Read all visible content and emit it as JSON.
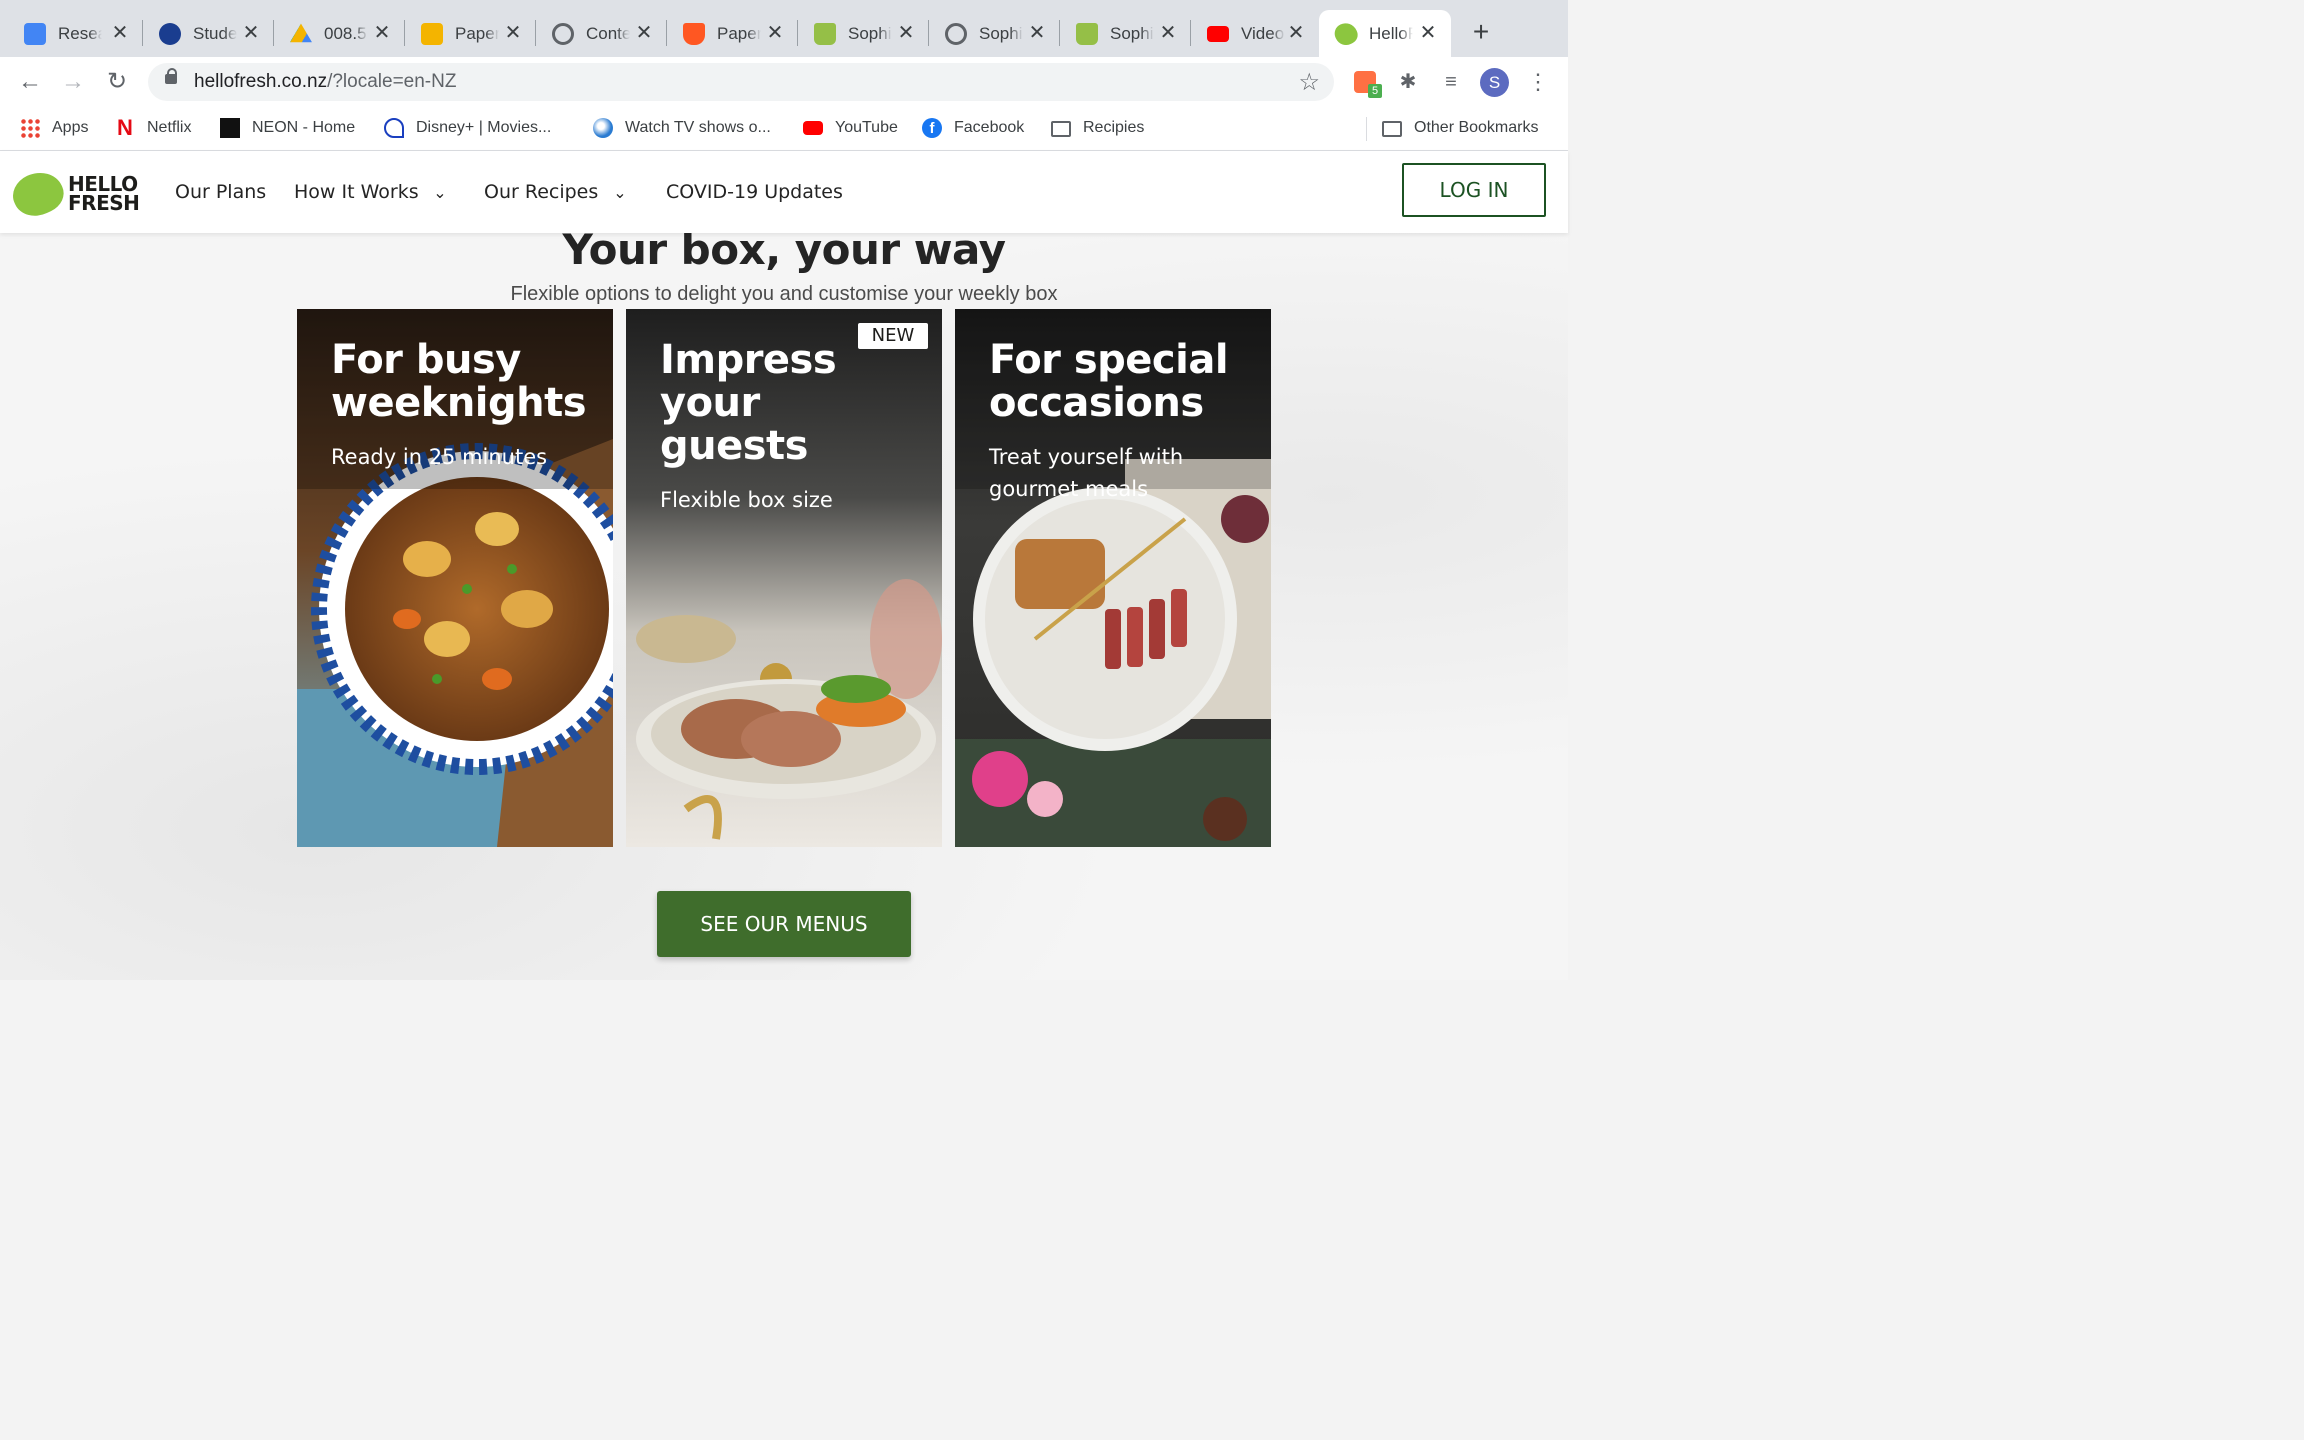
{
  "tabs": [
    {
      "title": "Research",
      "icon": "google-docs-icon",
      "color": "#4285f4"
    },
    {
      "title": "Student",
      "icon": "student-portal-icon",
      "color": "#1a3d8f"
    },
    {
      "title": "008.5",
      "icon": "google-drive-icon",
      "color": "#0f9d58"
    },
    {
      "title": "Paper",
      "icon": "google-slides-icon",
      "color": "#f4b400"
    },
    {
      "title": "Content",
      "icon": "globe-icon",
      "color": "#5f6368"
    },
    {
      "title": "Paper",
      "icon": "cup-icon",
      "color": "#ff5722"
    },
    {
      "title": "Sophia",
      "icon": "shopify-icon",
      "color": "#95bf47"
    },
    {
      "title": "Sophia",
      "icon": "globe-icon",
      "color": "#5f6368"
    },
    {
      "title": "Sophia",
      "icon": "shopify-icon",
      "color": "#95bf47"
    },
    {
      "title": "Video",
      "icon": "youtube-icon",
      "color": "#ff0000"
    },
    {
      "title": "HelloFresh",
      "icon": "hellofresh-icon",
      "color": "#8cc63f"
    }
  ],
  "browser": {
    "url_host": "hellofresh.co.nz",
    "url_path": "/?locale=en-NZ",
    "extension_badge": "5",
    "profile_initial": "S"
  },
  "bookmarks": [
    {
      "label": "Apps",
      "icon": "apps-grid-icon"
    },
    {
      "label": "Netflix",
      "icon": "netflix-icon"
    },
    {
      "label": "NEON - Home",
      "icon": "neon-icon"
    },
    {
      "label": "Disney+ | Movies...",
      "icon": "disney-plus-icon"
    },
    {
      "label": "Watch TV shows o...",
      "icon": "tv-globe-icon"
    },
    {
      "label": "YouTube",
      "icon": "youtube-icon"
    },
    {
      "label": "Facebook",
      "icon": "facebook-icon"
    },
    {
      "label": "Recipies",
      "icon": "folder-icon"
    }
  ],
  "other_bookmarks": "Other Bookmarks",
  "site": {
    "logo_line1": "HELLO",
    "logo_line2": "FRESH",
    "nav": {
      "our_plans": "Our Plans",
      "how_it_works": "How It Works",
      "our_recipes": "Our Recipes",
      "covid": "COVID-19 Updates"
    },
    "login": "LOG IN",
    "brand_color": "#1c5223"
  },
  "section": {
    "title": "Your box, your way",
    "subtitle": "Flexible options to delight you and customise your weekly box"
  },
  "cards": [
    {
      "line1": "For busy",
      "line2": "weeknights",
      "sub": "Ready in 25 minutes"
    },
    {
      "line1": "Impress",
      "line2": "your",
      "line3": "guests",
      "sub": "Flexible box size",
      "badge": "NEW"
    },
    {
      "line1": "For special",
      "line2": "occasions",
      "sub1": "Treat yourself with",
      "sub2": "gourmet meals"
    }
  ],
  "cta": "SEE OUR MENUS"
}
